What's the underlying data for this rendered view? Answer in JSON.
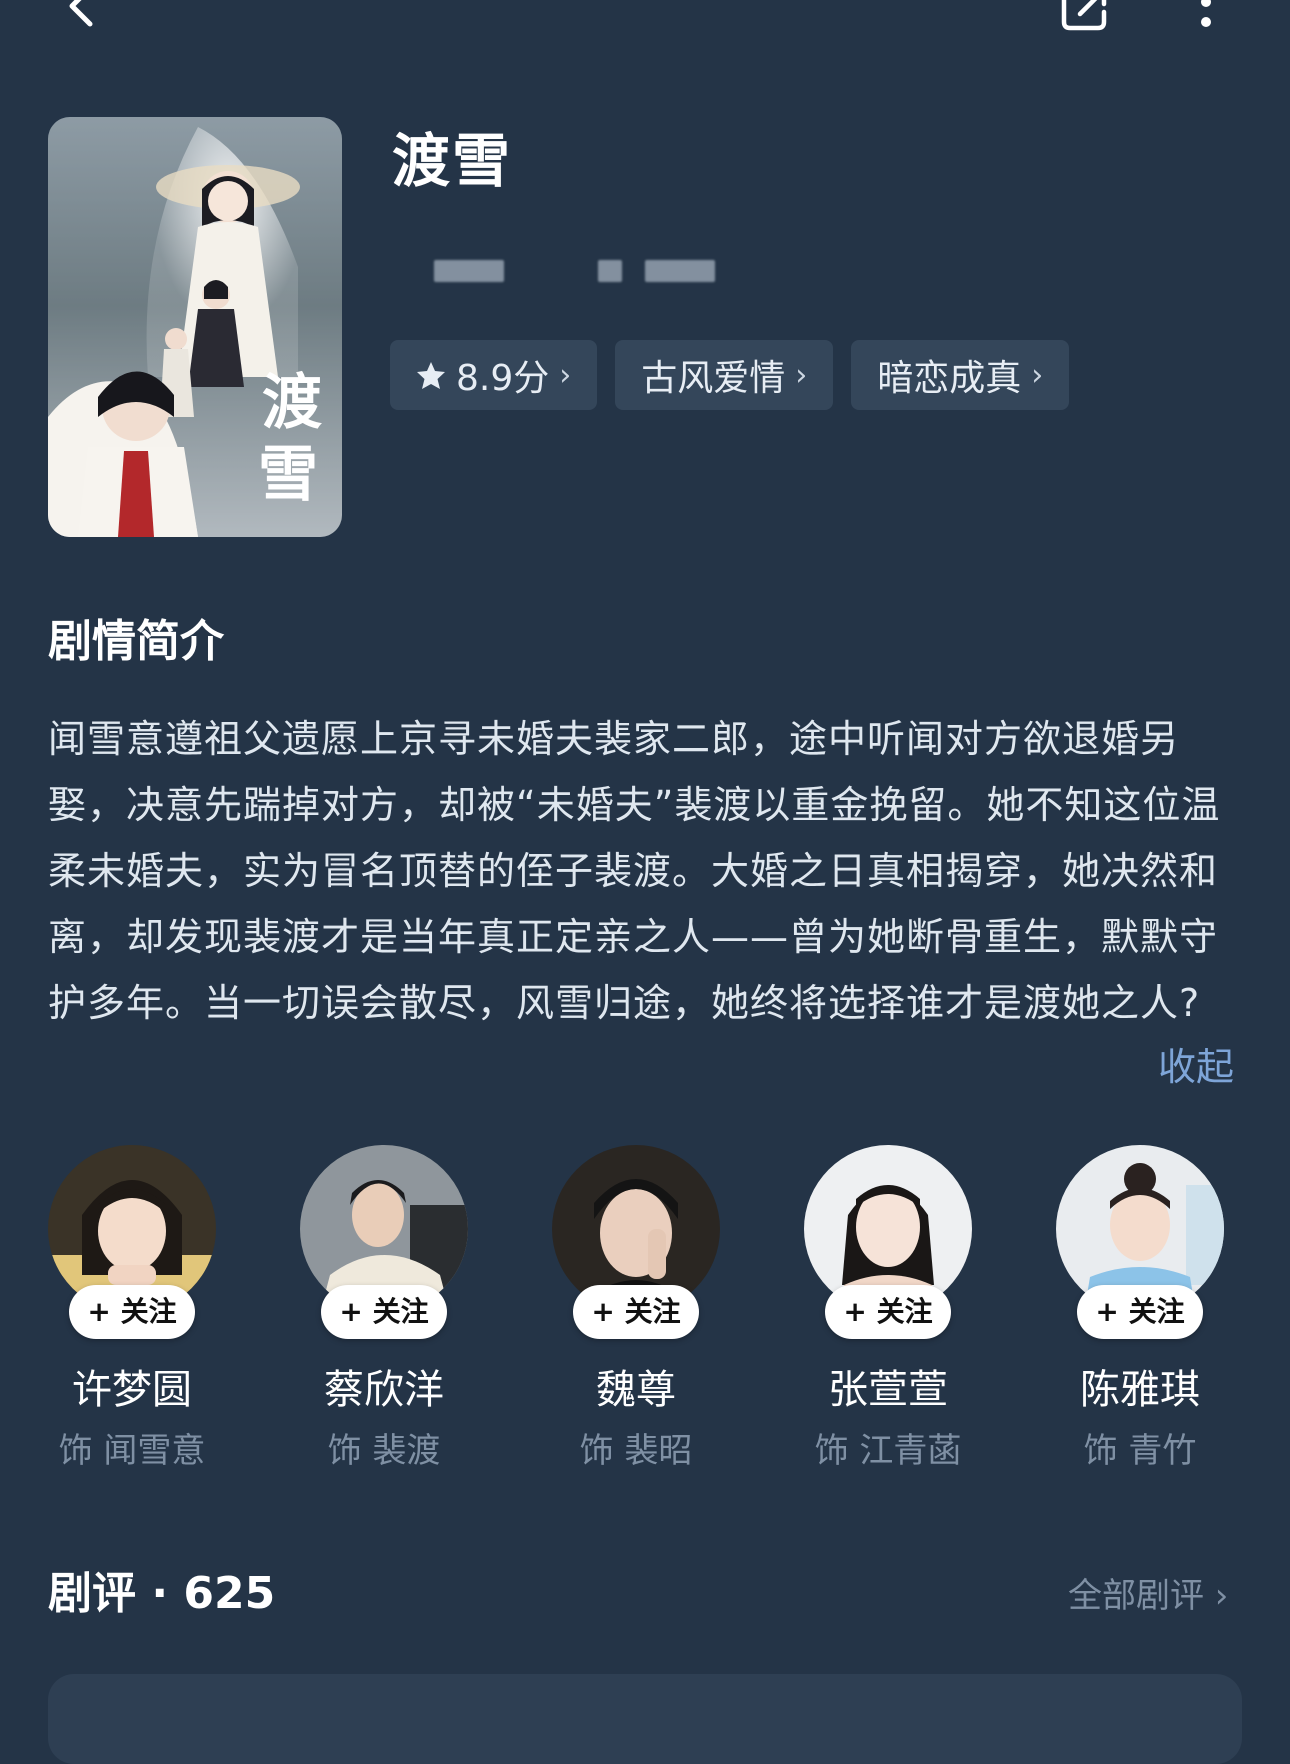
{
  "header": {
    "back_icon": "chevron-left-icon",
    "share_icon": "share-icon",
    "more_icon": "more-vertical-icon"
  },
  "show": {
    "title": "渡雪",
    "chips": [
      {
        "icon": "star-icon",
        "label": "8.9分"
      },
      {
        "label": "古风爱情"
      },
      {
        "label": "暗恋成真"
      }
    ]
  },
  "synopsis": {
    "heading": "剧情简介",
    "text": "闻雪意遵祖父遗愿上京寻未婚夫裴家二郎，途中听闻对方欲退婚另娶，决意先踹掉对方，却被“未婚夫”裴渡以重金挽留。她不知这位温柔未婚夫，实为冒名顶替的侄子裴渡。大婚之日真相揭穿，她决然和离，却发现裴渡才是当年真正定亲之人——曾为她断骨重生，默默守护多年。当一切误会散尽，风雪归途，她终将选择谁才是渡她之人?",
    "collapse_label": "收起"
  },
  "cast": [
    {
      "name": "许梦圆",
      "role": "饰 闻雪意",
      "follow_label": "+ 关注"
    },
    {
      "name": "蔡欣洋",
      "role": "饰 裴渡",
      "follow_label": "+ 关注"
    },
    {
      "name": "魏尊",
      "role": "饰 裴昭",
      "follow_label": "+ 关注"
    },
    {
      "name": "张萱萱",
      "role": "饰 江青菡",
      "follow_label": "+ 关注"
    },
    {
      "name": "陈雅琪",
      "role": "饰 青竹",
      "follow_label": "+ 关注"
    }
  ],
  "reviews": {
    "heading": "剧评 · 625",
    "all_label": "全部剧评 ›"
  },
  "colors": {
    "background": "#243447",
    "chip_bg": "#34465a",
    "link_blue": "#7ea5d8",
    "muted_text": "#7f90a4"
  }
}
